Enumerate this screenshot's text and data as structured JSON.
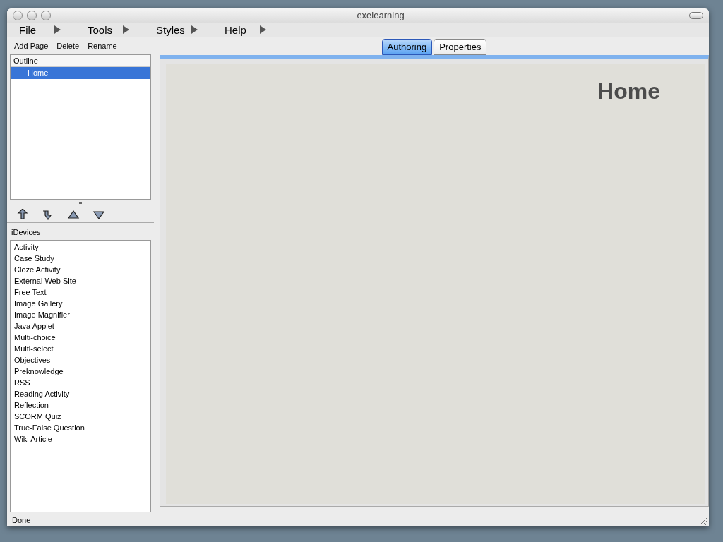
{
  "window": {
    "title": "exelearning"
  },
  "menu": [
    {
      "label": "File"
    },
    {
      "label": "Tools"
    },
    {
      "label": "Styles"
    },
    {
      "label": "Help"
    }
  ],
  "page_toolbar": [
    "Add Page",
    "Delete",
    "Rename"
  ],
  "outline": {
    "header": "Outline",
    "items": [
      {
        "label": "Home",
        "selected": true
      }
    ]
  },
  "idevices": {
    "header": "iDevices",
    "items": [
      "Activity",
      "Case Study",
      "Cloze Activity",
      "External Web Site",
      "Free Text",
      "Image Gallery",
      "Image Magnifier",
      "Java Applet",
      "Multi-choice",
      "Multi-select",
      "Objectives",
      "Preknowledge",
      "RSS",
      "Reading Activity",
      "Reflection",
      "SCORM Quiz",
      "True-False Question",
      "Wiki Article"
    ]
  },
  "tabs": [
    {
      "label": "Authoring",
      "selected": true
    },
    {
      "label": "Properties",
      "selected": false
    }
  ],
  "content": {
    "heading": "Home"
  },
  "status_bar": "Done"
}
